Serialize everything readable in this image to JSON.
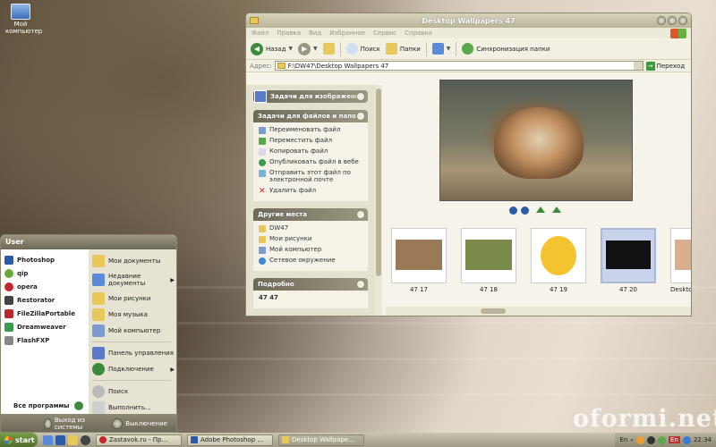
{
  "desktop": {
    "icon_label": "Мой компьютер",
    "watermark": "oformi.net"
  },
  "window": {
    "title": "Desktop Wallpapers 47",
    "menu": [
      "Файл",
      "Правка",
      "Вид",
      "Избранное",
      "Сервис",
      "Справка"
    ],
    "toolbar": {
      "back_label": "Назад",
      "search_label": "Поиск",
      "folders_label": "Папки",
      "sync_label": "Синхронизация папки"
    },
    "address": {
      "label": "Адрес:",
      "value": "F:\\DW47\\Desktop Wallpapers 47",
      "go_label": "Переход"
    },
    "taskpane": {
      "image_tasks_title": "Задачи для изображений",
      "file_tasks_title": "Задачи для файлов и папок",
      "file_tasks": [
        "Переименовать файл",
        "Переместить файл",
        "Копировать файл",
        "Опубликовать файл в вебе",
        "Отправить этот файл по электронной почте",
        "Удалить файл"
      ],
      "other_places_title": "Другие места",
      "other_places": [
        "DW47",
        "Мои рисунки",
        "Мой компьютер",
        "Сетевое окружение"
      ],
      "details_title": "Подробно",
      "details_cut_text": "47 47"
    },
    "thumbnails": [
      {
        "caption": "47 17",
        "color": "#9a7a56"
      },
      {
        "caption": "47 18",
        "color": "#7a8a4a"
      },
      {
        "caption": "47 19",
        "color": "#f4c430"
      },
      {
        "caption": "47 20",
        "color": "#111111"
      },
      {
        "caption": "Desktop",
        "color": "#d8b090"
      }
    ]
  },
  "start_menu": {
    "user": "User",
    "left_items": [
      {
        "label": "Photoshop",
        "color": "#2a5aa8"
      },
      {
        "label": "qip",
        "color": "#6aa83c"
      },
      {
        "label": "opera",
        "color": "#c8242c"
      },
      {
        "label": "Restorator",
        "color": "#444444"
      },
      {
        "label": "FileZillaPortable",
        "color": "#b8282c"
      },
      {
        "label": "Dreamweaver",
        "color": "#3c9a4c"
      },
      {
        "label": "FlashFXP",
        "color": "#888888"
      }
    ],
    "all_programs": "Все программы",
    "right_items": [
      {
        "label": "Мои документы",
        "color": "#e9c85b"
      },
      {
        "label": "Недавние документы",
        "color": "#5a8ad8"
      },
      {
        "label": "Мои рисунки",
        "color": "#e9c85b"
      },
      {
        "label": "Моя музыка",
        "color": "#e9c85b"
      },
      {
        "label": "Мой компьютер",
        "color": "#7c9cd0"
      }
    ],
    "right_items2": [
      {
        "label": "Панель управления",
        "color": "#5a7ac8"
      },
      {
        "label": "Подключение",
        "color": "#3c8a3c"
      }
    ],
    "right_items3": [
      {
        "label": "Поиск",
        "color": "#bbbbbb"
      },
      {
        "label": "Выполнить...",
        "color": "#cfcfcf"
      }
    ],
    "logoff_label": "Выход из системы",
    "shutdown_label": "Выключение"
  },
  "taskbar": {
    "start_label": "start",
    "tasks": [
      {
        "label": "Zastavok.ru - Пр...",
        "color": "#c8242c"
      },
      {
        "label": "Adobe Photoshop ...",
        "color": "#2a5aa8"
      },
      {
        "label": "Desktop Wallpape...",
        "color": "#e9c85b"
      }
    ],
    "lang_en": "En",
    "lang_tag": "En",
    "clock": "22:34"
  }
}
